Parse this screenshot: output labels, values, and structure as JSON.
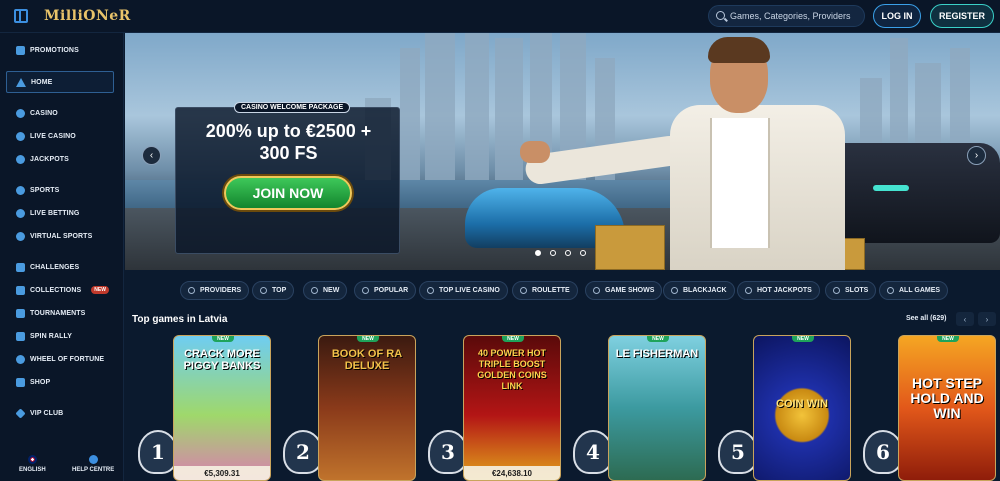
{
  "header": {
    "logo_text": "MilliONeR",
    "search_placeholder": "Games, Categories, Providers",
    "login_label": "LOG IN",
    "register_label": "REGISTER"
  },
  "sidebar": {
    "items": [
      {
        "label": "PROMOTIONS",
        "icon": "megaphone-icon"
      },
      {
        "label": "HOME",
        "icon": "home-icon",
        "active": true
      },
      {
        "label": "CASINO",
        "icon": "spade-icon"
      },
      {
        "label": "LIVE CASINO",
        "icon": "chip-icon"
      },
      {
        "label": "JACKPOTS",
        "icon": "jackpot-icon"
      },
      {
        "label": "SPORTS",
        "icon": "ball-icon"
      },
      {
        "label": "LIVE BETTING",
        "icon": "live-icon"
      },
      {
        "label": "VIRTUAL SPORTS",
        "icon": "virtual-icon"
      },
      {
        "label": "CHALLENGES",
        "icon": "swords-icon"
      },
      {
        "label": "COLLECTIONS",
        "icon": "collections-icon",
        "badge": "NEW"
      },
      {
        "label": "TOURNAMENTS",
        "icon": "trophy-icon"
      },
      {
        "label": "SPIN RALLY",
        "icon": "spin-icon"
      },
      {
        "label": "WHEEL OF FORTUNE",
        "icon": "wheel-icon"
      },
      {
        "label": "SHOP",
        "icon": "shop-icon"
      },
      {
        "label": "VIP CLUB",
        "icon": "diamond-icon"
      }
    ],
    "footer": {
      "language": "ENGLISH",
      "help": "HELP CENTRE"
    }
  },
  "banner": {
    "tag": "CASINO WELCOME PACKAGE",
    "title_line1": "200% up to €2500 +",
    "title_line2": "300 FS",
    "cta": "JOIN NOW",
    "slides": 4,
    "active_slide": 1
  },
  "categories": [
    {
      "label": "PROVIDERS",
      "icon": "providers-icon"
    },
    {
      "label": "TOP",
      "icon": "crown-icon"
    },
    {
      "label": "NEW",
      "icon": "lightning-icon"
    },
    {
      "label": "POPULAR",
      "icon": "flame-icon"
    },
    {
      "label": "TOP LIVE CASINO",
      "icon": "live-casino-icon"
    },
    {
      "label": "ROULETTE",
      "icon": "roulette-icon"
    },
    {
      "label": "GAME SHOWS",
      "icon": "microphone-icon"
    },
    {
      "label": "BLACKJACK",
      "icon": "cards-icon"
    },
    {
      "label": "HOT JACKPOTS",
      "icon": "hot-jackpot-icon"
    },
    {
      "label": "SLOTS",
      "icon": "slots-icon"
    },
    {
      "label": "ALL GAMES",
      "icon": "grid-icon"
    }
  ],
  "top_games": {
    "title": "Top games in Latvia",
    "see_all": "See all (629)",
    "games": [
      {
        "rank": "1",
        "name": "CRACK MORE PIGGY BANKS",
        "badge": "NEW",
        "jackpot": "€5,309.31",
        "color": "#4fb6e8"
      },
      {
        "rank": "2",
        "name": "BOOK OF RA DELUXE",
        "badge": "NEW",
        "jackpot": "",
        "color": "#7a2b1a"
      },
      {
        "rank": "3",
        "name": "40 POWER HOT TRIPLE BOOST GOLDEN COINS LINK",
        "badge": "NEW",
        "jackpot": "€24,638.10",
        "color": "#8f1010"
      },
      {
        "rank": "4",
        "name": "LE FISHERMAN",
        "badge": "NEW",
        "jackpot": "",
        "color": "#2f8a8f"
      },
      {
        "rank": "5",
        "name": "COIN WIN",
        "badge": "NEW",
        "jackpot": "",
        "color": "#1d2f9a"
      },
      {
        "rank": "6",
        "name": "HOT STEP HOLD AND WIN",
        "badge": "NEW",
        "jackpot": "",
        "color": "#e2581a"
      }
    ]
  }
}
